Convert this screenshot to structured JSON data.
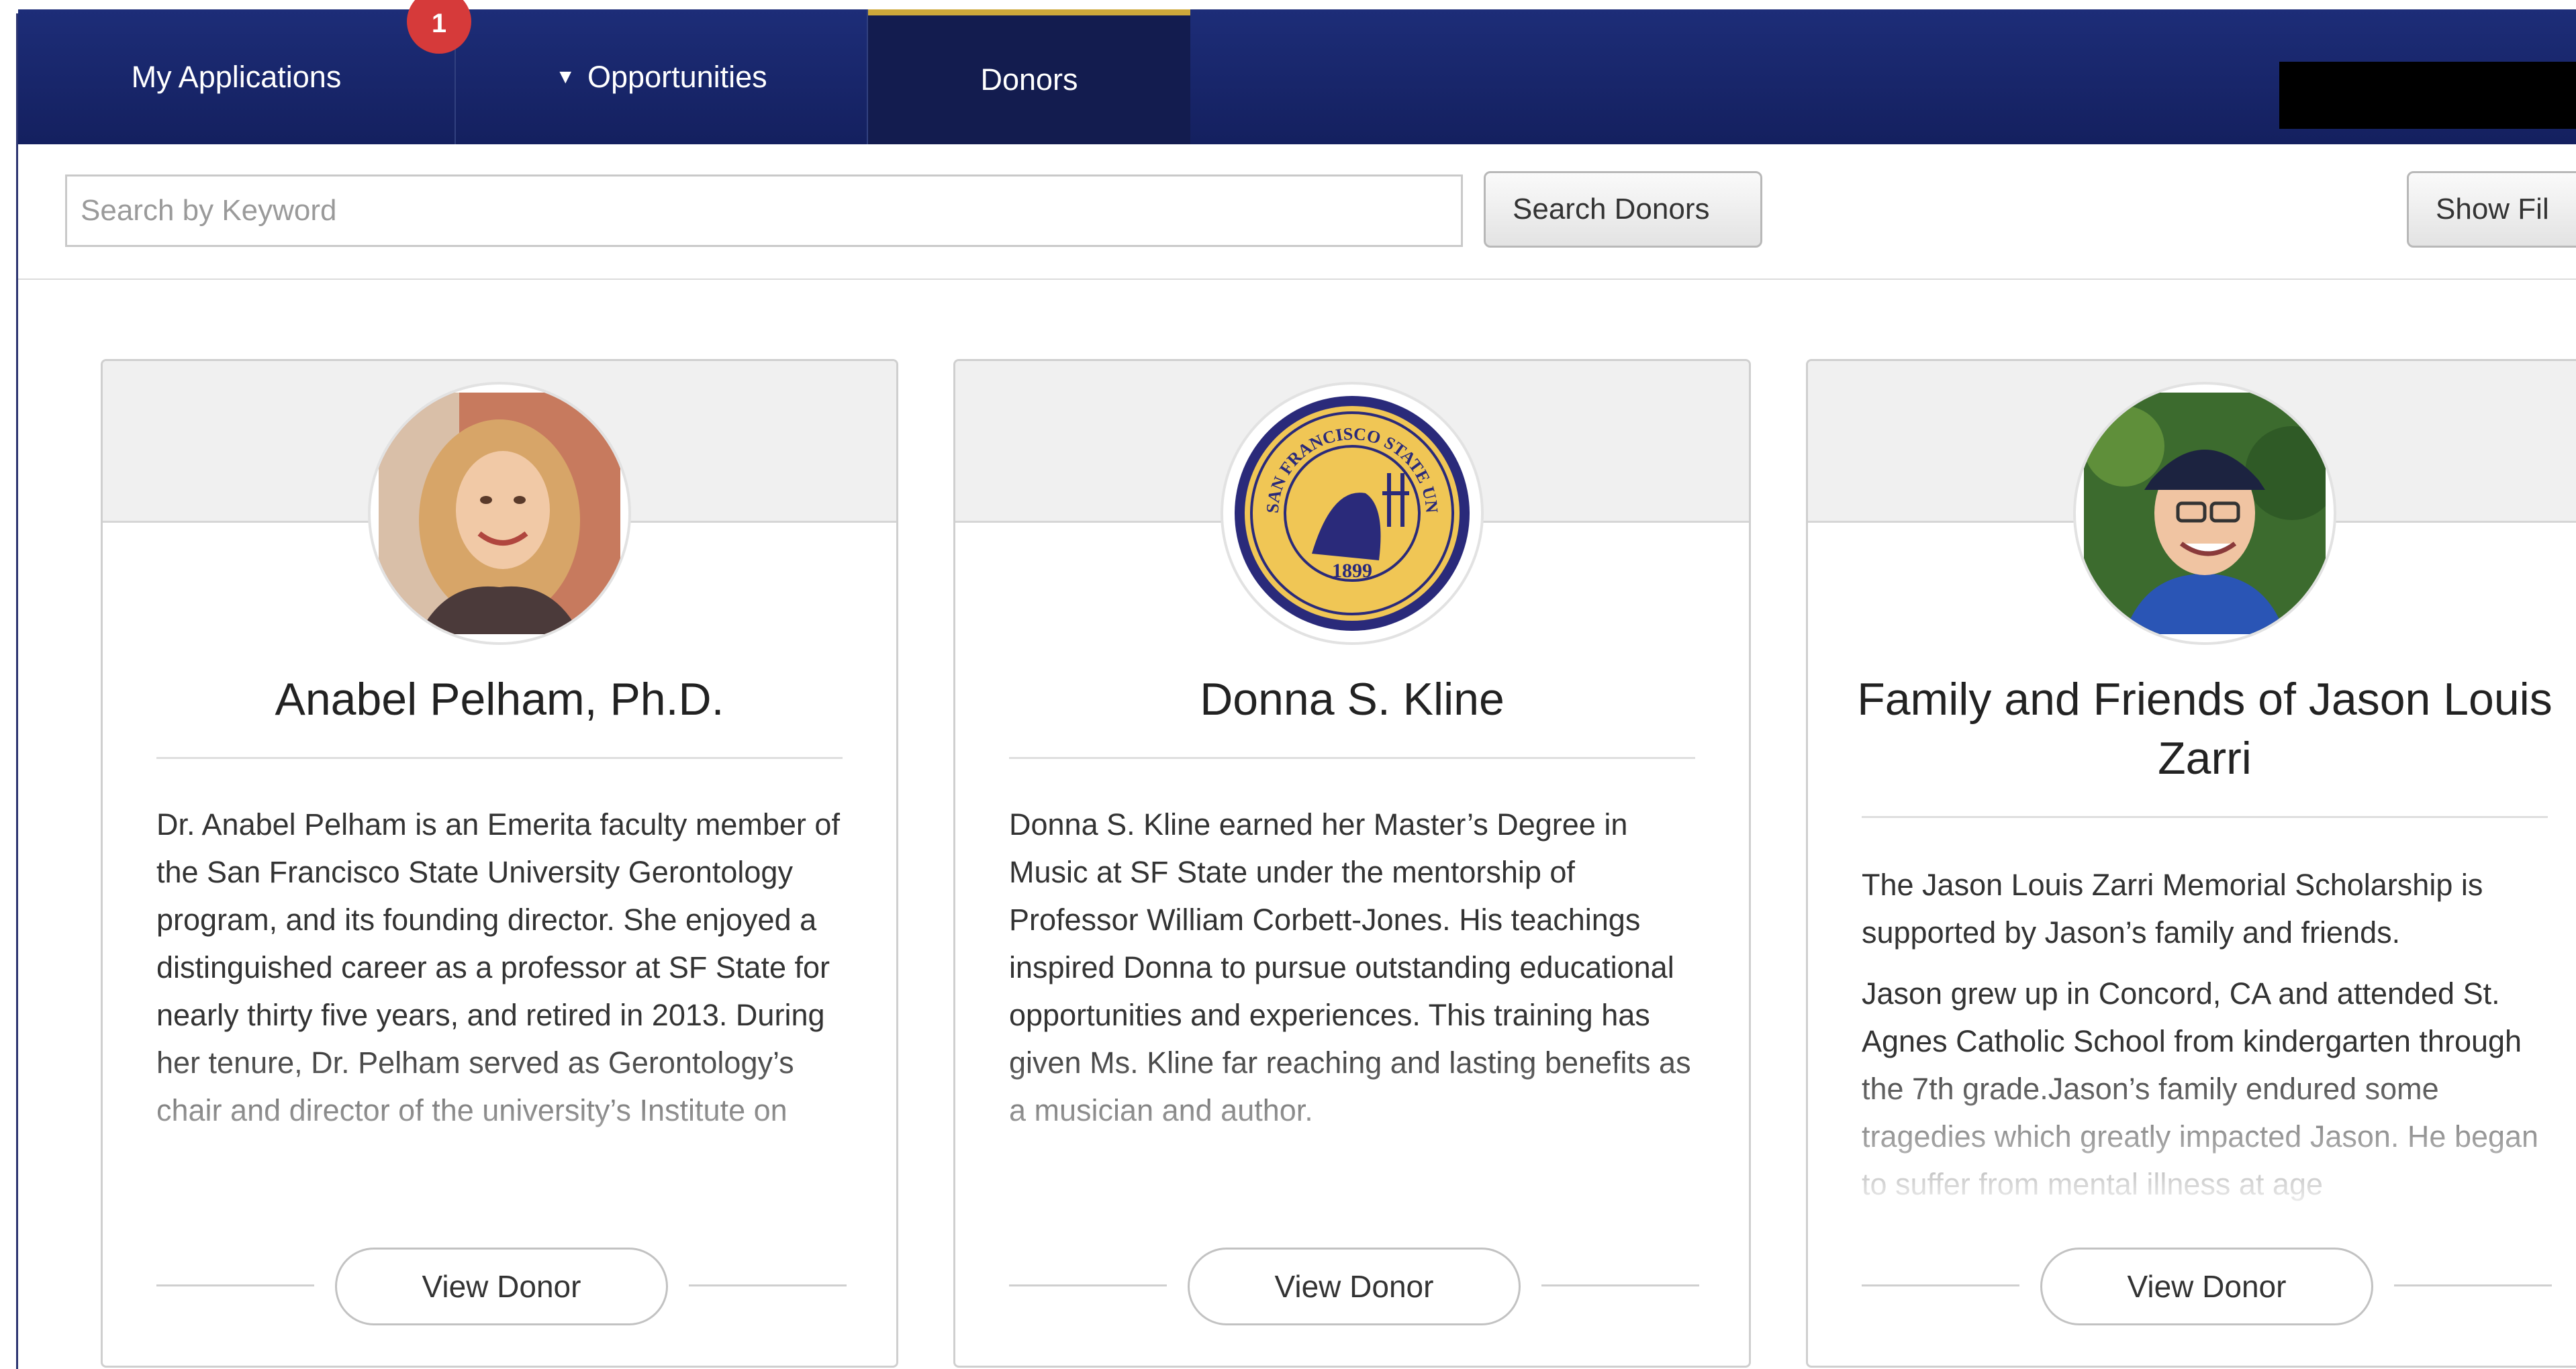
{
  "nav": {
    "items": [
      {
        "label": "My Applications",
        "badge": "1"
      },
      {
        "label": "Opportunities",
        "icon": "triangle-down-icon"
      },
      {
        "label": "Donors",
        "active": true
      }
    ],
    "accent_color": "#cda83a",
    "bar_color": "#1d2d78"
  },
  "search": {
    "placeholder": "Search by Keyword",
    "value": "",
    "search_button": "Search Donors",
    "filter_button": "Show Fil"
  },
  "cards": [
    {
      "name": "Anabel Pelham, Ph.D.",
      "avatar": "person-photo-icon",
      "paragraphs": [
        "Dr. Anabel Pelham is an Emerita faculty member of the San Francisco State University Gerontology program, and its founding director. She enjoyed a distinguished career as a professor at SF State for nearly thirty five years, and retired in 2013. During her tenure, Dr. Pelham served as Gerontology’s chair and director of the university’s Institute on"
      ],
      "button": "View Donor"
    },
    {
      "name": "Donna S. Kline",
      "avatar": "university-seal-icon",
      "seal_text": "SAN FRANCISCO STATE UNIVERSITY",
      "seal_year": "1899",
      "paragraphs": [
        "Donna S. Kline earned her Master’s Degree in Music at SF State under the mentorship of Professor William Corbett-Jones. His teachings inspired Donna to pursue outstanding educational opportunities and experiences. This training has given Ms. Kline far reaching and lasting benefits as a musician and author."
      ],
      "button": "View Donor"
    },
    {
      "name": "Family and Friends of Jason Louis Zarri",
      "avatar": "person-photo-icon",
      "paragraphs": [
        "The Jason Louis Zarri Memorial Scholarship is supported by Jason’s family and friends.",
        "Jason grew up in Concord, CA and attended St. Agnes Catholic School from kindergarten through the 7th grade.Jason’s family endured some tragedies which greatly impacted Jason. He began to suffer from mental illness at age"
      ],
      "button": "View Donor"
    }
  ]
}
